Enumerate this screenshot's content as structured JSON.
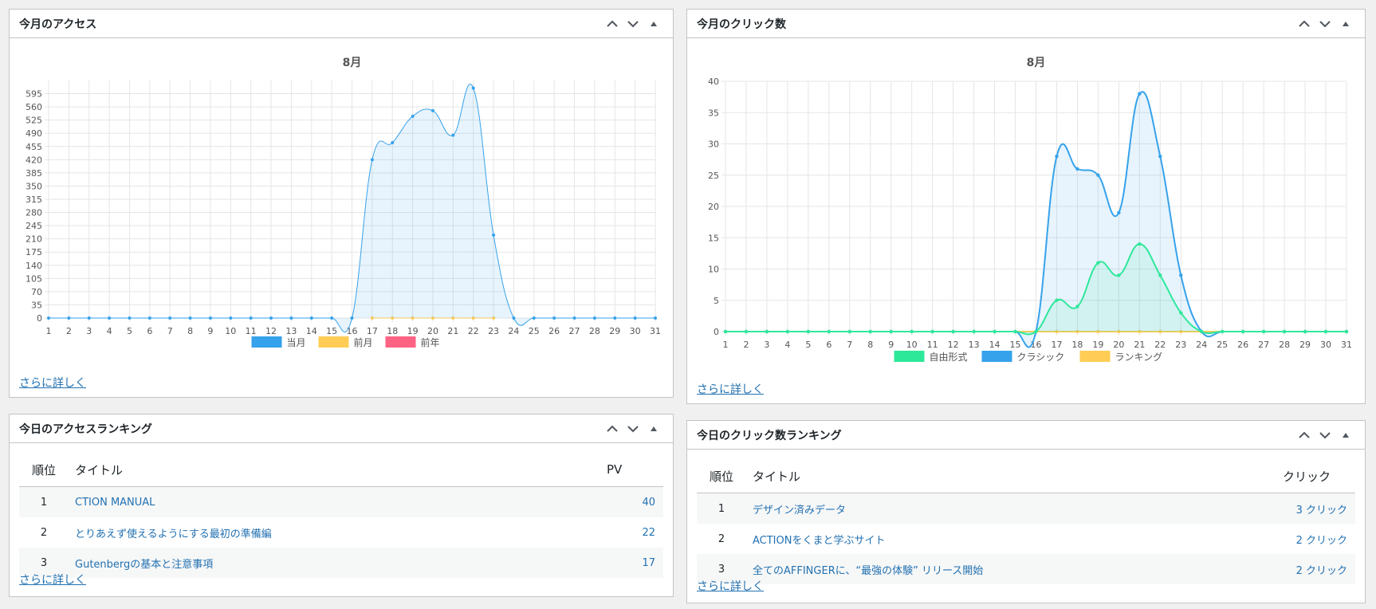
{
  "access_panel": {
    "title": "今月のアクセス",
    "more": "さらに詳しく",
    "chart_data": {
      "type": "line",
      "title": "8月",
      "categories": [
        "1",
        "2",
        "3",
        "4",
        "5",
        "6",
        "7",
        "8",
        "9",
        "10",
        "11",
        "12",
        "13",
        "14",
        "15",
        "16",
        "17",
        "18",
        "19",
        "20",
        "21",
        "22",
        "23",
        "24",
        "25",
        "26",
        "27",
        "28",
        "29",
        "30",
        "31"
      ],
      "yticks": [
        0,
        35,
        70,
        105,
        140,
        175,
        210,
        245,
        280,
        315,
        350,
        385,
        420,
        455,
        490,
        525,
        560,
        595
      ],
      "ylim": [
        0,
        630
      ],
      "grid": true,
      "legend": "bottom",
      "series": [
        {
          "name": "当月",
          "color": "#36a2eb",
          "fill": true,
          "values": [
            0,
            0,
            0,
            0,
            0,
            0,
            0,
            0,
            0,
            0,
            0,
            0,
            0,
            0,
            0,
            0,
            420,
            465,
            535,
            550,
            485,
            610,
            220,
            0,
            0,
            0,
            0,
            0,
            0,
            0,
            0
          ]
        },
        {
          "name": "前月",
          "color": "#ffcd56",
          "fill": false,
          "values": [
            null,
            null,
            null,
            null,
            null,
            null,
            null,
            null,
            null,
            null,
            null,
            null,
            null,
            null,
            null,
            null,
            0,
            0,
            0,
            0,
            0,
            0,
            0,
            null,
            null,
            null,
            null,
            null,
            null,
            null,
            null
          ]
        },
        {
          "name": "前年",
          "color": "#ff6384",
          "fill": false,
          "values": []
        }
      ]
    }
  },
  "click_panel": {
    "title": "今月のクリック数",
    "more": "さらに詳しく",
    "chart_data": {
      "type": "line",
      "title": "8月",
      "categories": [
        "1",
        "2",
        "3",
        "4",
        "5",
        "6",
        "7",
        "8",
        "9",
        "10",
        "11",
        "12",
        "13",
        "14",
        "15",
        "16",
        "17",
        "18",
        "19",
        "20",
        "21",
        "22",
        "23",
        "24",
        "25",
        "26",
        "27",
        "28",
        "29",
        "30",
        "31"
      ],
      "yticks": [
        0,
        5,
        10,
        15,
        20,
        25,
        30,
        35,
        40
      ],
      "ylim": [
        0,
        40
      ],
      "grid": true,
      "legend": "bottom",
      "series": [
        {
          "name": "自由形式",
          "color": "#2ee89a",
          "fill": true,
          "values": [
            0,
            0,
            0,
            0,
            0,
            0,
            0,
            0,
            0,
            0,
            0,
            0,
            0,
            0,
            0,
            0,
            5,
            4,
            11,
            9,
            14,
            9,
            3,
            0,
            0,
            0,
            0,
            0,
            0,
            0,
            0
          ]
        },
        {
          "name": "クラシック",
          "color": "#36a2eb",
          "fill": true,
          "values": [
            0,
            0,
            0,
            0,
            0,
            0,
            0,
            0,
            0,
            0,
            0,
            0,
            0,
            0,
            0,
            0,
            28,
            26,
            25,
            19,
            38,
            28,
            9,
            0,
            0,
            0,
            0,
            0,
            0,
            0,
            0
          ]
        },
        {
          "name": "ランキング",
          "color": "#ffcd56",
          "fill": false,
          "values": [
            0,
            0,
            0,
            0,
            0,
            0,
            0,
            0,
            0,
            0,
            0,
            0,
            0,
            0,
            0,
            0,
            0,
            0,
            0,
            0,
            0,
            0,
            0,
            0,
            0,
            0,
            0,
            0,
            0,
            0,
            0
          ]
        }
      ]
    }
  },
  "access_ranking": {
    "title": "今日のアクセスランキング",
    "headers": {
      "rank": "順位",
      "title": "タイトル",
      "count": "PV"
    },
    "rows": [
      {
        "rank": "1",
        "title": "CTION MANUAL",
        "count": "40"
      },
      {
        "rank": "2",
        "title": "とりあえず使えるようにする最初の準備編",
        "count": "22"
      },
      {
        "rank": "3",
        "title": "Gutenbergの基本と注意事項",
        "count": "17"
      }
    ],
    "more": "さらに詳しく"
  },
  "click_ranking": {
    "title": "今日のクリック数ランキング",
    "headers": {
      "rank": "順位",
      "title": "タイトル",
      "count": "クリック"
    },
    "rows": [
      {
        "rank": "1",
        "title": "デザイン済みデータ",
        "count": "3 クリック"
      },
      {
        "rank": "2",
        "title": "ACTIONをくまと学ぶサイト",
        "count": "2 クリック"
      },
      {
        "rank": "3",
        "title": "全てのAFFINGERに、“最強の体験” リリース開始",
        "count": "2 クリック"
      }
    ],
    "more": "さらに詳しく"
  }
}
